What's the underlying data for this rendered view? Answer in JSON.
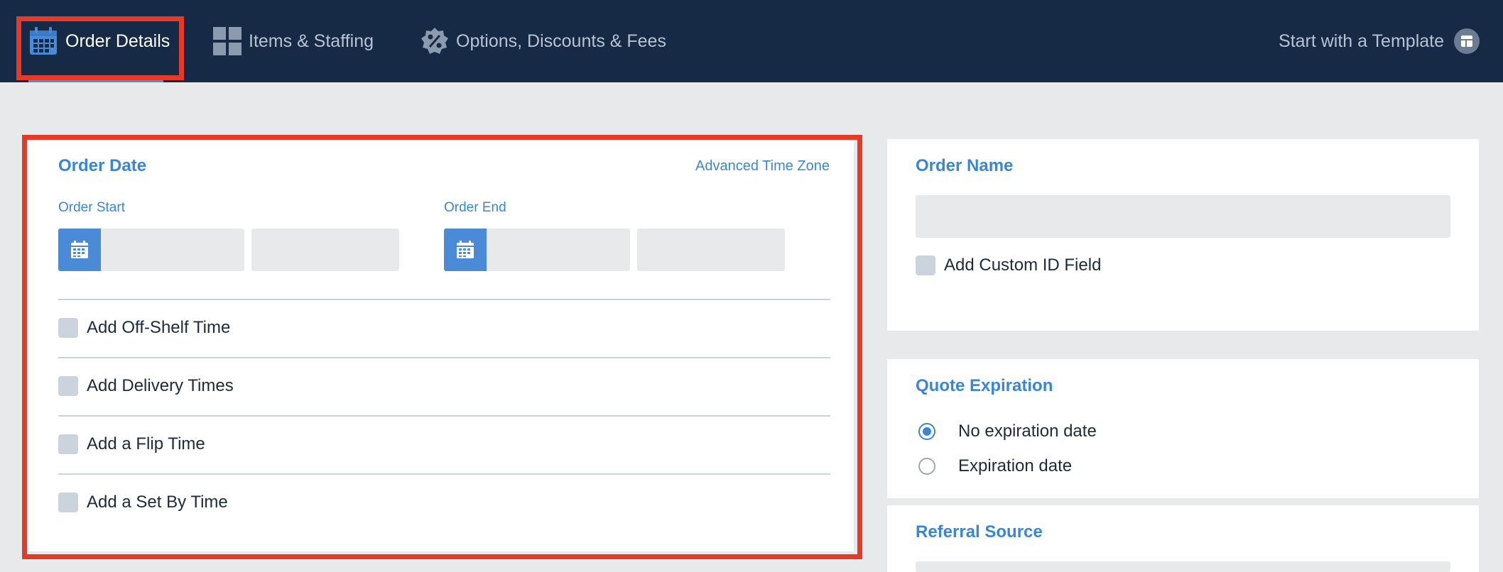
{
  "nav": {
    "tabs": [
      {
        "label": "Order Details",
        "icon": "calendar-icon",
        "active": true
      },
      {
        "label": "Items & Staffing",
        "icon": "grid-icon",
        "active": false
      },
      {
        "label": "Options, Discounts & Fees",
        "icon": "percent-badge-icon",
        "active": false
      }
    ],
    "template_label": "Start with a Template",
    "template_icon": "template-icon"
  },
  "order_date": {
    "title": "Order Date",
    "advanced_link": "Advanced Time Zone",
    "start_label": "Order Start",
    "end_label": "Order End",
    "start_date_value": "",
    "start_time_value": "",
    "end_date_value": "",
    "end_time_value": "",
    "options": [
      {
        "label": "Add Off-Shelf Time",
        "checked": false
      },
      {
        "label": "Add Delivery Times",
        "checked": false
      },
      {
        "label": "Add a Flip Time",
        "checked": false
      },
      {
        "label": "Add a Set By Time",
        "checked": false
      }
    ]
  },
  "order_name": {
    "title": "Order Name",
    "value": "",
    "custom_id_label": "Add Custom ID Field"
  },
  "quote_expiration": {
    "title": "Quote Expiration",
    "options": [
      {
        "label": "No expiration date",
        "selected": true
      },
      {
        "label": "Expiration date",
        "selected": false
      }
    ]
  },
  "referral_source": {
    "title": "Referral Source"
  },
  "colors": {
    "nav_bg": "#172a45",
    "accent_blue": "#3a86d4",
    "highlight_red": "#e53a27"
  }
}
